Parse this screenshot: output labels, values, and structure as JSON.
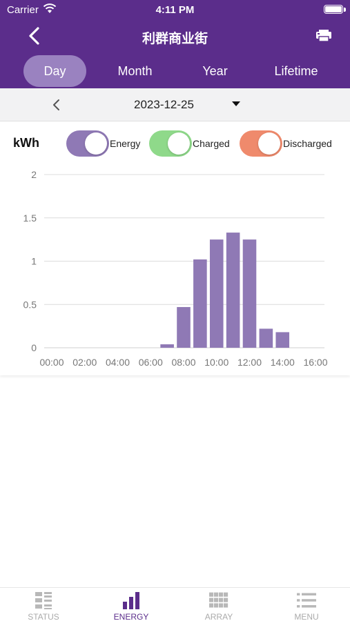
{
  "status_bar": {
    "carrier": "Carrier",
    "time": "4:11 PM"
  },
  "nav": {
    "title": "利群商业街"
  },
  "tabs": [
    {
      "label": "Day",
      "active": true
    },
    {
      "label": "Month",
      "active": false
    },
    {
      "label": "Year",
      "active": false
    },
    {
      "label": "Lifetime",
      "active": false
    }
  ],
  "date_bar": {
    "date": "2023-12-25"
  },
  "legend": {
    "unit": "kWh",
    "toggles": [
      {
        "label": "Energy",
        "color": "#8f79b5",
        "on": true
      },
      {
        "label": "Charged",
        "color": "#8fd98a",
        "on": true
      },
      {
        "label": "Discharged",
        "color": "#ef8a6c",
        "on": true
      }
    ]
  },
  "chart_data": {
    "type": "bar",
    "ylim": [
      0,
      2
    ],
    "yticks": [
      "0",
      "0.5",
      "1",
      "1.5",
      "2"
    ],
    "xlim": [
      0,
      16
    ],
    "xticks": [
      "00:00",
      "02:00",
      "04:00",
      "06:00",
      "08:00",
      "10:00",
      "12:00",
      "14:00",
      "16:00"
    ],
    "bar_color": "#8f79b5",
    "series": [
      {
        "name": "Energy",
        "points": [
          {
            "hour": 7,
            "value": 0.04
          },
          {
            "hour": 8,
            "value": 0.47
          },
          {
            "hour": 9,
            "value": 1.02
          },
          {
            "hour": 10,
            "value": 1.25
          },
          {
            "hour": 11,
            "value": 1.33
          },
          {
            "hour": 12,
            "value": 1.25
          },
          {
            "hour": 13,
            "value": 0.22
          },
          {
            "hour": 14,
            "value": 0.18
          }
        ]
      }
    ]
  },
  "bottom_tabs": [
    {
      "label": "STATUS",
      "icon": "status-grid-icon",
      "active": false
    },
    {
      "label": "ENERGY",
      "icon": "bar-chart-icon",
      "active": true
    },
    {
      "label": "ARRAY",
      "icon": "array-panels-icon",
      "active": false
    },
    {
      "label": "MENU",
      "icon": "menu-list-icon",
      "active": false
    }
  ]
}
